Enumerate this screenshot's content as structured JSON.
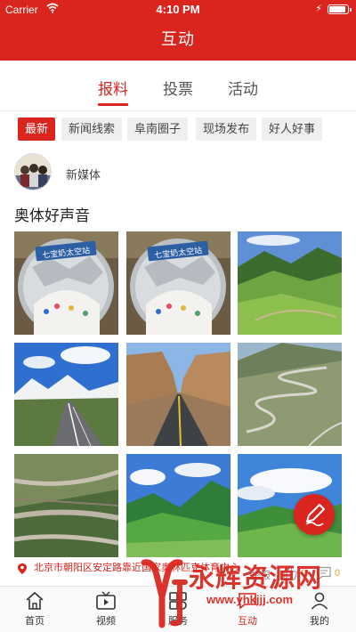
{
  "status_bar": {
    "carrier": "Carrier",
    "time": "4:10 PM",
    "battery_level": 0.9
  },
  "header": {
    "title": "互动"
  },
  "tabs": [
    {
      "label": "报料",
      "active": true
    },
    {
      "label": "投票",
      "active": false
    },
    {
      "label": "活动",
      "active": false
    }
  ],
  "categories": [
    {
      "label": "最新",
      "active": true
    },
    {
      "label": "新闻线索",
      "active": false
    },
    {
      "label": "阜南圈子",
      "active": false
    },
    {
      "label": "现场发布",
      "active": false
    },
    {
      "label": "好人好事",
      "active": false
    }
  ],
  "post": {
    "author": "新媒体",
    "title": "奥体好声音",
    "location": "北京市朝阳区安定路靠近国家奥林匹克体育中心",
    "report_label": "举报",
    "like_count": "0",
    "comment_count": "0",
    "images": [
      {
        "kind": "snack-sign",
        "sign_text": "七宝奶太空站"
      },
      {
        "kind": "snack-sign",
        "sign_text": "七宝奶太空站"
      },
      {
        "kind": "green-valley"
      },
      {
        "kind": "snowy-road"
      },
      {
        "kind": "canyon-road"
      },
      {
        "kind": "winding-mountain-road"
      },
      {
        "kind": "aerial-road"
      },
      {
        "kind": "green-mountains"
      },
      {
        "kind": "meadow-hills"
      }
    ]
  },
  "bottom_nav": [
    {
      "label": "首页",
      "icon": "home-icon",
      "active": false
    },
    {
      "label": "视频",
      "icon": "tv-icon",
      "active": false
    },
    {
      "label": "服务",
      "icon": "service-icon",
      "active": false
    },
    {
      "label": "互动",
      "icon": "interact-icon",
      "active": true
    },
    {
      "label": "我的",
      "icon": "user-icon",
      "active": false
    }
  ],
  "watermark": {
    "title": "永辉资源网",
    "url": "www.yhkjjj.com"
  },
  "colors": {
    "brand_red": "#d9251d",
    "chip_bg": "#efefef",
    "count_orange": "#e2a437"
  }
}
